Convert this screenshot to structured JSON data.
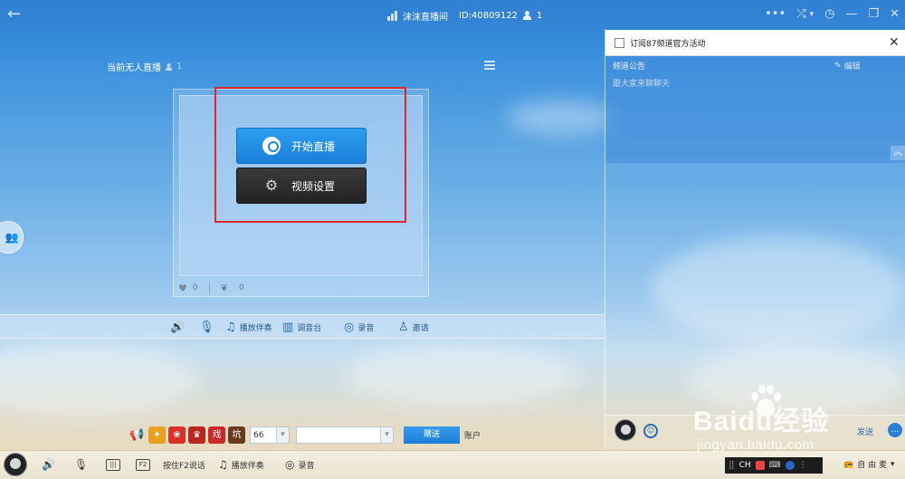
{
  "titlebar": {
    "room_name": "沫沫直播间",
    "room_id": "ID:40809122",
    "viewer_count": "1",
    "controls": [
      "•••",
      "⤮",
      "▾",
      "◷",
      "—",
      "❐",
      "✕"
    ]
  },
  "stage": {
    "status_text": "当前无人直播",
    "online_count": "1",
    "start_live_label": "开始直播",
    "video_settings_label": "视频设置",
    "likes": "0",
    "flowers": "0"
  },
  "toolbar": {
    "items": [
      {
        "label": "",
        "icon": "speaker-icon"
      },
      {
        "label": "",
        "icon": "microphone-icon"
      },
      {
        "label": "播放伴奏",
        "icon": "music-note-icon"
      },
      {
        "label": "调音台",
        "icon": "mixer-icon"
      },
      {
        "label": "录音",
        "icon": "record-icon"
      },
      {
        "label": "邀请",
        "icon": "invite-icon"
      }
    ]
  },
  "gift_row": {
    "count_value": "66",
    "send_label": "赠送",
    "account_label": "账户",
    "gifts": [
      {
        "glyph": "✦",
        "color": "#e8a020"
      },
      {
        "glyph": "❀",
        "color": "#d8302a"
      },
      {
        "glyph": "♛",
        "color": "#b8281f"
      },
      {
        "glyph": "戏",
        "color": "#c82a2a"
      },
      {
        "glyph": "坑",
        "color": "#6b3a1a"
      }
    ]
  },
  "bottom_bar": {
    "items": [
      {
        "label": "",
        "icon": "speaker-icon"
      },
      {
        "label": "",
        "icon": "microphone-icon"
      },
      {
        "label": "",
        "icon": "mixer-icon"
      },
      {
        "label": "",
        "icon": "f2-key-icon"
      },
      {
        "label": "按住F2说话",
        "icon": ""
      },
      {
        "label": "播放伴奏",
        "icon": "music-note-icon"
      },
      {
        "label": "录音",
        "icon": "record-icon"
      }
    ],
    "ime_label": "CH",
    "tray_text": "自 由 麦"
  },
  "right_panel": {
    "subscribe_label": "订阅87频道官方活动",
    "notice_title": "频道公告",
    "edit_label": "编辑",
    "notice_body": "跟大家来聊聊天",
    "send_label": "发送"
  },
  "watermark": {
    "brand": "Baidu经验",
    "url": "jingyan.baidu.com"
  },
  "colors": {
    "accent": "#1a7fd9",
    "titlebar": "#3181d4",
    "highlight": "#e0262d"
  }
}
